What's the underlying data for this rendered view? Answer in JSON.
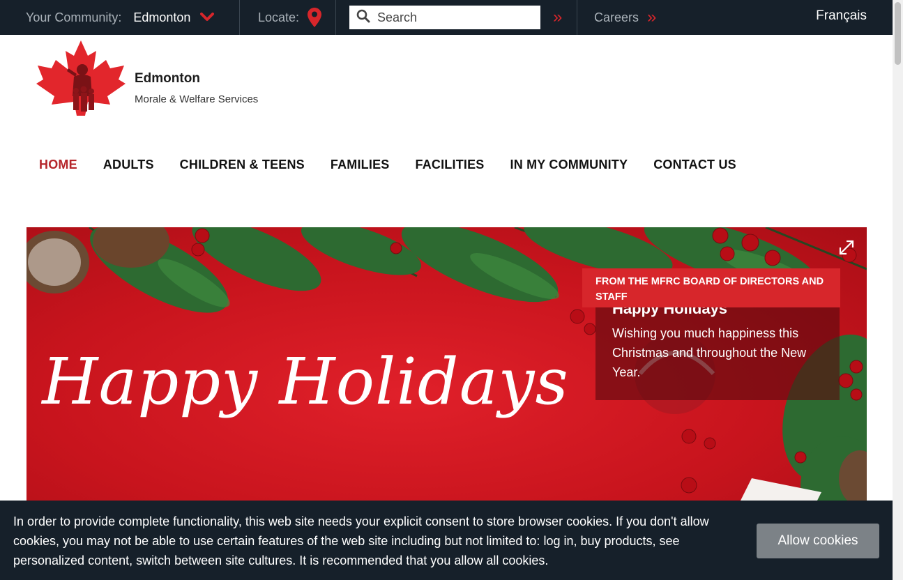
{
  "topbar": {
    "community_label": "Your Community:",
    "community_value": "Edmonton",
    "locate_label": "Locate:",
    "search_placeholder": "Search",
    "careers_label": "Careers",
    "language_link": "Français",
    "arrow_glyph": "»"
  },
  "brand": {
    "name": "Edmonton",
    "subtitle": "Morale & Welfare Services"
  },
  "nav": {
    "items": [
      {
        "label": "HOME",
        "active": true
      },
      {
        "label": "ADULTS"
      },
      {
        "label": "CHILDREN & TEENS"
      },
      {
        "label": "FAMILIES"
      },
      {
        "label": "FACILITIES"
      },
      {
        "label": "IN MY COMMUNITY"
      },
      {
        "label": "CONTACT US"
      }
    ]
  },
  "hero": {
    "script_text": "Happy Holidays",
    "caption_tag": "FROM THE MFRC BOARD OF DIRECTORS AND STAFF",
    "caption_title": "Happy Holidays",
    "caption_text": "Wishing you much happiness this Christmas and throughout the New Year."
  },
  "cookie": {
    "message": "In order to provide complete functionality, this web site needs your explicit consent to store browser cookies. If you don't allow cookies, you may not be able to use certain features of the web site including but not limited to: log in, buy products, see personalized content, switch between site cultures. It is recommended that you allow all cookies.",
    "button_label": "Allow cookies"
  },
  "colors": {
    "topbar_bg": "#16202a",
    "accent_red": "#d7262b",
    "nav_active": "#b5252a",
    "cookie_button": "#7c8287"
  }
}
